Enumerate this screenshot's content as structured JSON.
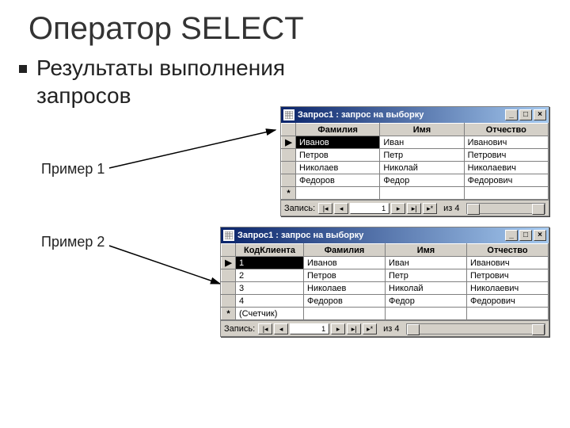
{
  "title": "Оператор SELECT",
  "subtitle": "Результаты выполнения запросов",
  "labels": {
    "ex1": "Пример 1",
    "ex2": "Пример 2"
  },
  "nav": {
    "record_label": "Запись:",
    "first": "|◂",
    "prev": "◂",
    "next": "▸",
    "last": "▸|",
    "new": "▸*",
    "of": "из"
  },
  "window1": {
    "title": "Запрос1 : запрос на выборку",
    "columns": [
      "Фамилия",
      "Имя",
      "Отчество"
    ],
    "rows": [
      {
        "sel": "▶",
        "c": [
          "Иванов",
          "Иван",
          "Иванович"
        ],
        "highlight": 0
      },
      {
        "sel": "",
        "c": [
          "Петров",
          "Петр",
          "Петрович"
        ]
      },
      {
        "sel": "",
        "c": [
          "Николаев",
          "Николай",
          "Николаевич"
        ]
      },
      {
        "sel": "",
        "c": [
          "Федоров",
          "Федор",
          "Федорович"
        ]
      },
      {
        "sel": "*",
        "c": [
          "",
          "",
          ""
        ]
      }
    ],
    "current": "1",
    "total": "4"
  },
  "window2": {
    "title": "Запрос1 : запрос на выборку",
    "columns": [
      "КодКлиента",
      "Фамилия",
      "Имя",
      "Отчество"
    ],
    "rows": [
      {
        "sel": "▶",
        "c": [
          "1",
          "Иванов",
          "Иван",
          "Иванович"
        ],
        "highlight": 0
      },
      {
        "sel": "",
        "c": [
          "2",
          "Петров",
          "Петр",
          "Петрович"
        ]
      },
      {
        "sel": "",
        "c": [
          "3",
          "Николаев",
          "Николай",
          "Николаевич"
        ]
      },
      {
        "sel": "",
        "c": [
          "4",
          "Федоров",
          "Федор",
          "Федорович"
        ]
      },
      {
        "sel": "*",
        "c": [
          "(Счетчик)",
          "",
          "",
          ""
        ]
      }
    ],
    "current": "1",
    "total": "4",
    "numeric_col": 0
  }
}
